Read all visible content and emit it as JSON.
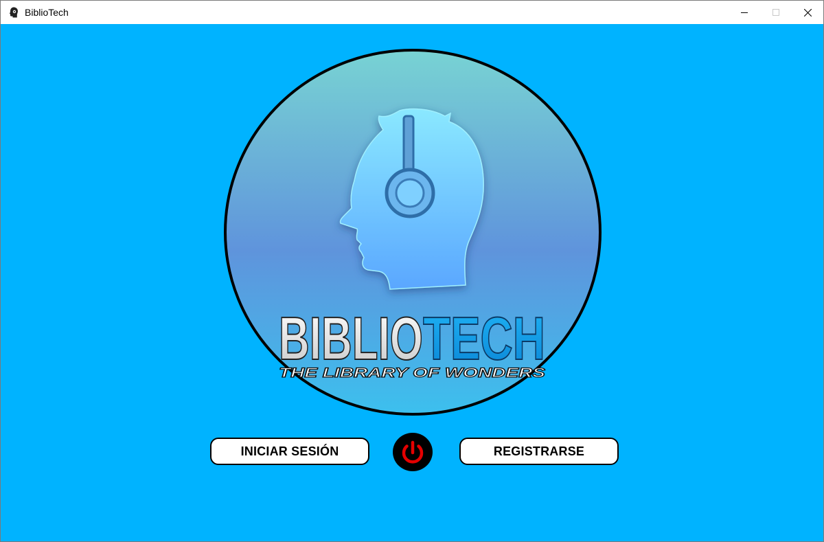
{
  "window": {
    "title": "BiblioTech",
    "icon": "head-silhouette-icon"
  },
  "logo": {
    "brand_part1": "BIBLIO",
    "brand_part2": "TECH",
    "tagline": "THE LIBRARY OF WONDERS",
    "icon": "head-with-headphones-icon"
  },
  "actions": {
    "login_label": "INICIAR SESIÓN",
    "register_label": "REGISTRARSE",
    "power_icon": "power-icon"
  },
  "colors": {
    "background": "#00b3ff",
    "power_red": "#e60000",
    "tech_blue": "#0a9be6"
  }
}
